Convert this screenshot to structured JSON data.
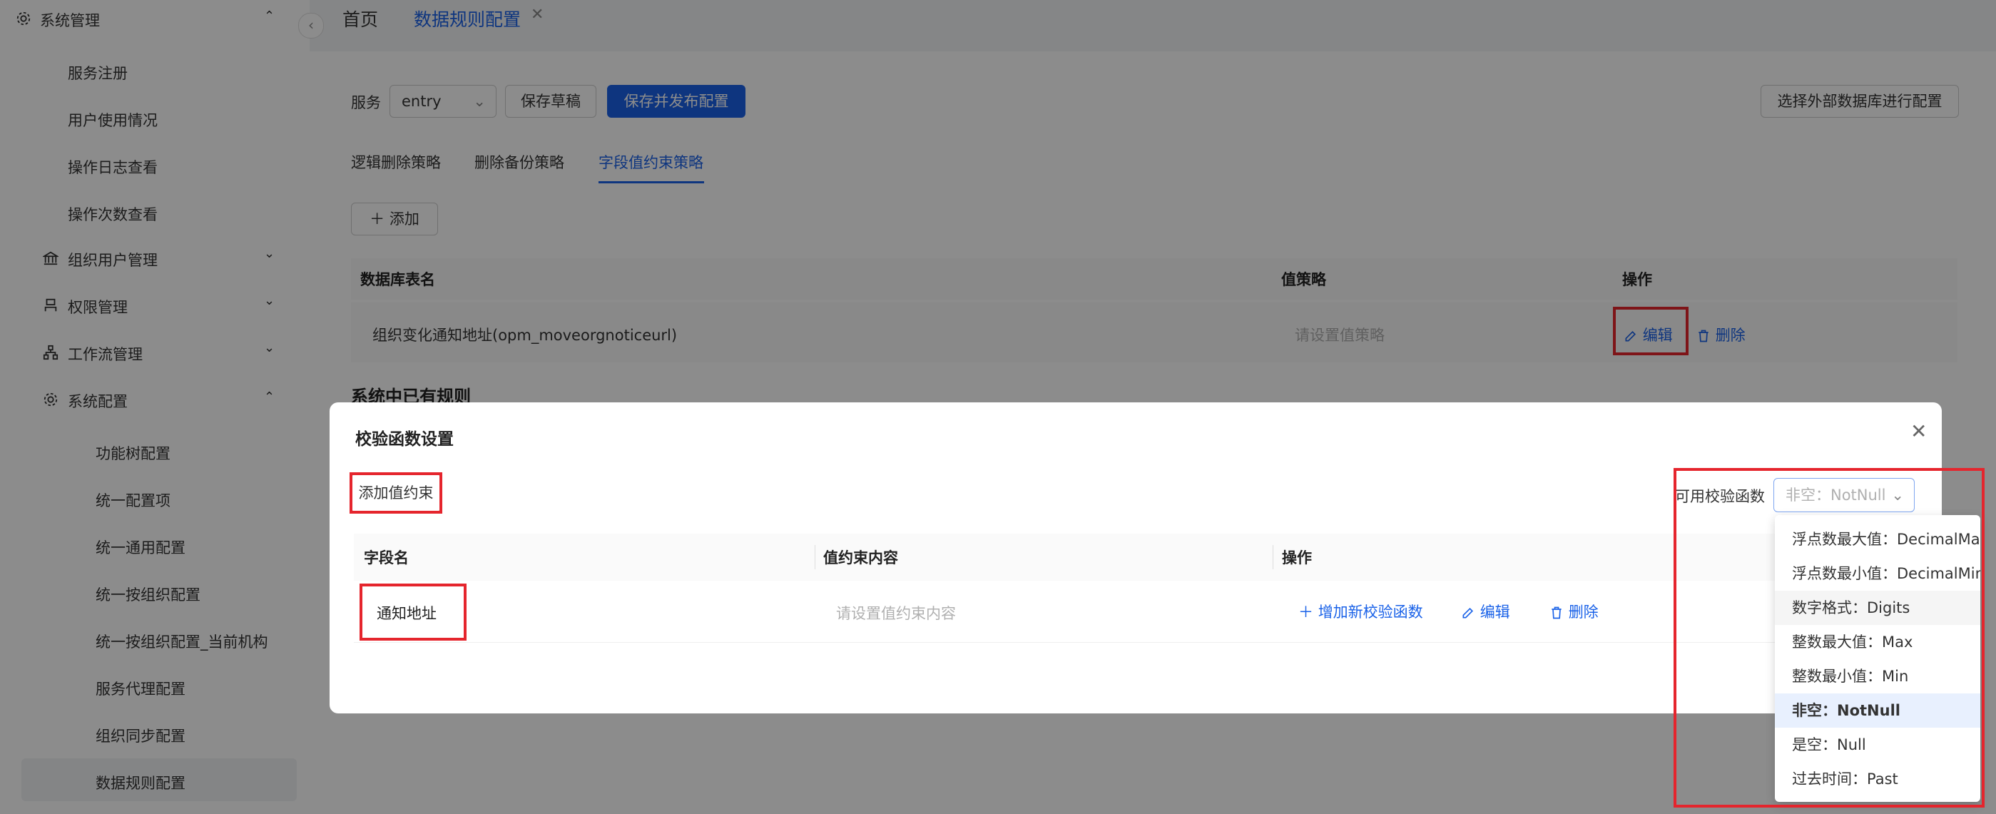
{
  "sidebar": {
    "group_system_mgmt": "系统管理",
    "items_system_mgmt": [
      "服务注册",
      "用户使用情况",
      "操作日志查看",
      "操作次数查看"
    ],
    "group_org_user": "组织用户管理",
    "group_permission": "权限管理",
    "group_workflow": "工作流管理",
    "group_system_config": "系统配置",
    "items_system_config": [
      "功能树配置",
      "统一配置项",
      "统一通用配置",
      "统一按组织配置",
      "统一按组织配置_当前机构",
      "服务代理配置",
      "组织同步配置",
      "数据规则配置"
    ]
  },
  "tabs": [
    {
      "label": "首页"
    },
    {
      "label": "数据规则配置"
    }
  ],
  "toolbar": {
    "service_label": "服务",
    "service_value": "entry",
    "save_draft": "保存草稿",
    "save_publish": "保存并发布配置",
    "external_db": "选择外部数据库进行配置"
  },
  "subtabs": [
    "逻辑删除策略",
    "删除备份策略",
    "字段值约束策略"
  ],
  "add_button": "添加",
  "table": {
    "headers": [
      "数据库表名",
      "值策略",
      "操作"
    ],
    "row": {
      "table_name": "组织变化通知地址(opm_moveorgnoticeurl)",
      "value_placeholder": "请设置值策略",
      "edit": "编辑",
      "delete": "删除"
    }
  },
  "section_title": "系统中已有规则",
  "modal": {
    "title": "校验函数设置",
    "add_constraint": "添加值约束",
    "available_label": "可用校验函数",
    "select_value": "非空：NotNull",
    "headers": [
      "字段名",
      "值约束内容",
      "操作"
    ],
    "row": {
      "field": "通知地址",
      "content_placeholder": "请设置值约束内容",
      "add_fn": "增加新校验函数",
      "edit": "编辑",
      "delete": "删除"
    }
  },
  "dropdown_options": [
    {
      "label": "浮点数最大值：DecimalMax"
    },
    {
      "label": "浮点数最小值：DecimalMin"
    },
    {
      "label": "数字格式：Digits"
    },
    {
      "label": "整数最大值：Max"
    },
    {
      "label": "整数最小值：Min"
    },
    {
      "label": "非空：NotNull"
    },
    {
      "label": "是空：Null"
    },
    {
      "label": "过去时间：Past"
    }
  ],
  "colors": {
    "accent": "#1a62e8",
    "highlight": "#e5252d"
  },
  "icons": [
    "gear-icon",
    "bank-icon",
    "person-icon",
    "flow-icon",
    "chevron-up-icon",
    "chevron-down-icon",
    "close-icon",
    "edit-icon",
    "trash-icon",
    "plus-icon"
  ]
}
